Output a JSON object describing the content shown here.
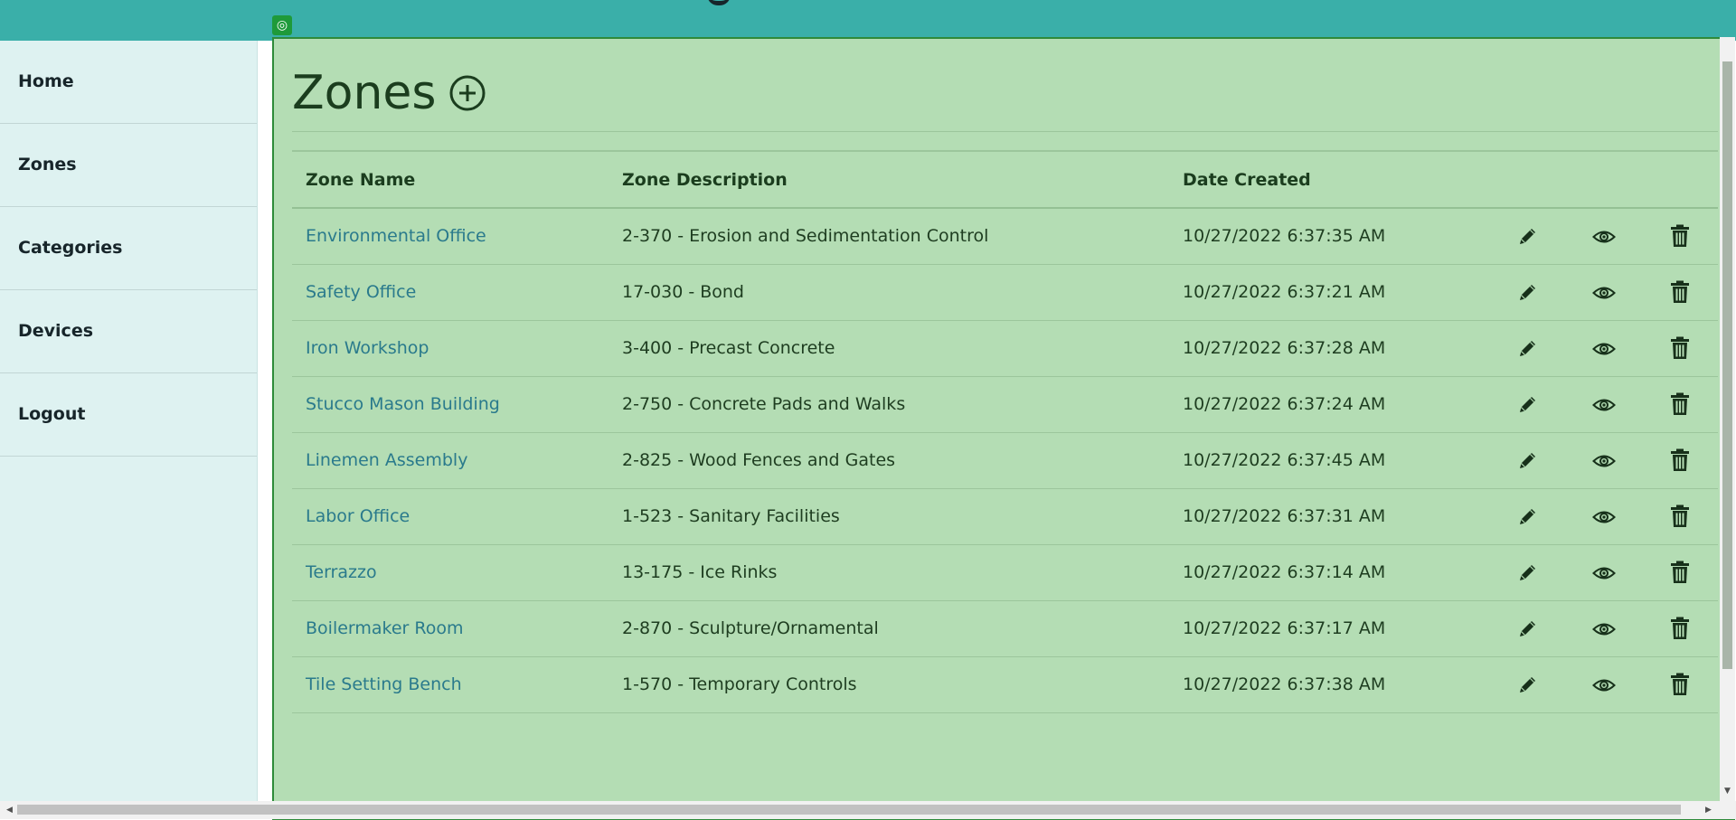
{
  "header": {
    "brand_color": "#3aafa9"
  },
  "sidebar": {
    "items": [
      {
        "label": "Home"
      },
      {
        "label": "Zones"
      },
      {
        "label": "Categories"
      },
      {
        "label": "Devices"
      },
      {
        "label": "Logout"
      }
    ]
  },
  "main": {
    "title": "Zones",
    "add_icon": "plus-circle-icon",
    "table": {
      "columns": [
        "Zone Name",
        "Zone Description",
        "Date Created"
      ],
      "rows": [
        {
          "name": "Environmental Office",
          "description": "2-370 - Erosion and Sedimentation Control",
          "created": "10/27/2022 6:37:35 AM"
        },
        {
          "name": "Safety Office",
          "description": "17-030 - Bond",
          "created": "10/27/2022 6:37:21 AM"
        },
        {
          "name": "Iron Workshop",
          "description": "3-400 - Precast Concrete",
          "created": "10/27/2022 6:37:28 AM"
        },
        {
          "name": "Stucco Mason Building",
          "description": "2-750 - Concrete Pads and Walks",
          "created": "10/27/2022 6:37:24 AM"
        },
        {
          "name": "Linemen Assembly",
          "description": "2-825 - Wood Fences and Gates",
          "created": "10/27/2022 6:37:45 AM"
        },
        {
          "name": "Labor Office",
          "description": "1-523 - Sanitary Facilities",
          "created": "10/27/2022 6:37:31 AM"
        },
        {
          "name": "Terrazzo",
          "description": "13-175 - Ice Rinks",
          "created": "10/27/2022 6:37:14 AM"
        },
        {
          "name": "Boilermaker Room",
          "description": "2-870 - Sculpture/Ornamental",
          "created": "10/27/2022 6:37:17 AM"
        },
        {
          "name": "Tile Setting Bench",
          "description": "1-570 - Temporary Controls",
          "created": "10/27/2022 6:37:38 AM"
        }
      ],
      "row_actions": [
        "pencil-icon",
        "eye-icon",
        "trash-icon"
      ]
    }
  },
  "colors": {
    "sidebar_bg": "#def2f1",
    "main_bg": "#b4ddb4",
    "link": "#2a7a8c",
    "text_dark": "#17252a"
  }
}
